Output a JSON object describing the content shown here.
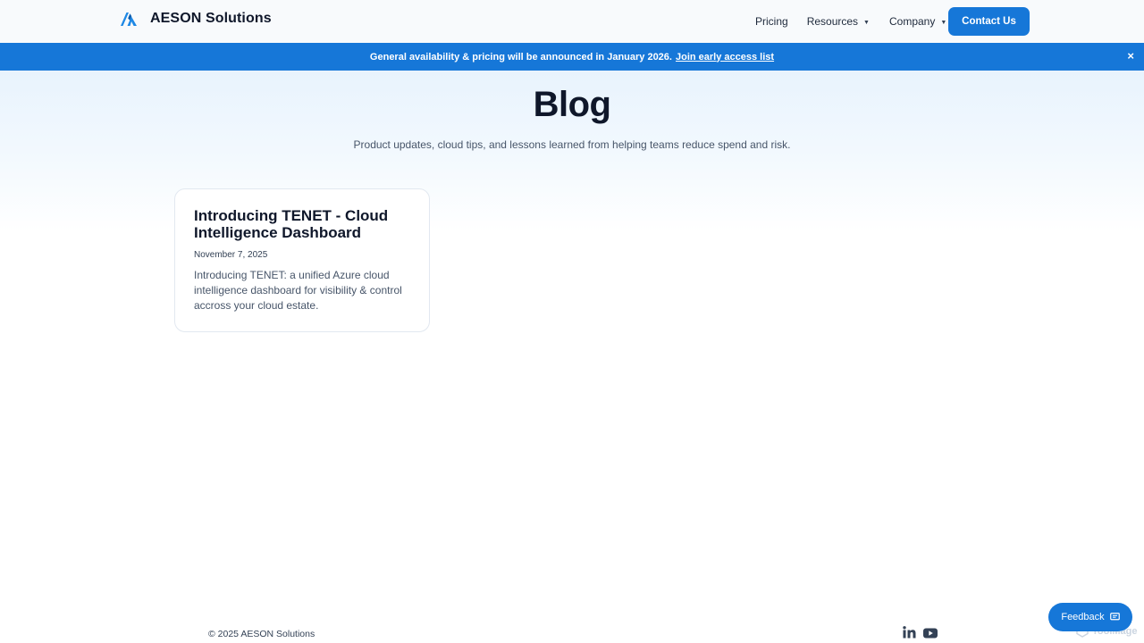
{
  "header": {
    "brand_name": "AESON Solutions",
    "logo_icon": "aeson-logo-icon",
    "nav": [
      {
        "label": "Pricing",
        "has_dropdown": false
      },
      {
        "label": "Resources",
        "has_dropdown": true
      },
      {
        "label": "Company",
        "has_dropdown": true
      }
    ],
    "contact_label": "Contact Us"
  },
  "banner": {
    "text": "General availability & pricing will be announced in January 2026.",
    "link_text": "Join early access list",
    "close_glyph": "×"
  },
  "hero": {
    "title": "Blog",
    "subtitle": "Product updates, cloud tips, and lessons learned from helping teams reduce spend and risk."
  },
  "posts": [
    {
      "title": "Introducing TENET - Cloud Intelligence Dashboard",
      "date": "November 7, 2025",
      "excerpt": "Introducing TENET: a unified Azure cloud intelligence dashboard for visibility & control accross your cloud estate."
    }
  ],
  "footer": {
    "copyright": "© 2025 AESON Solutions",
    "social_icons": [
      "linkedin-icon",
      "youtube-icon"
    ]
  },
  "feedback": {
    "label": "Feedback",
    "icon": "message-icon"
  },
  "watermark": {
    "label": "ToolMage"
  },
  "colors": {
    "accent": "#1677d8",
    "text_dark": "#0f172a",
    "text_muted": "#475569",
    "hero_tint": "#e8f3fd"
  }
}
